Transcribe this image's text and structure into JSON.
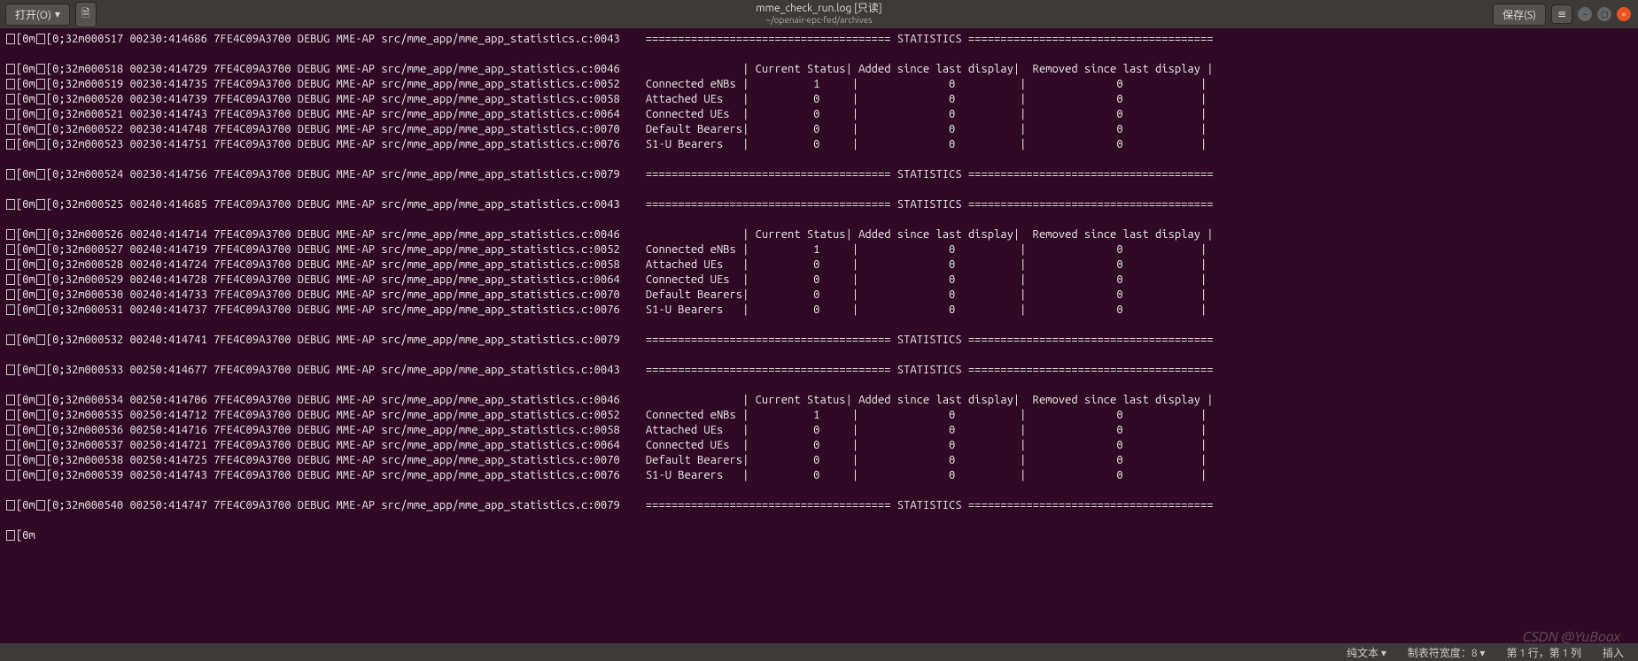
{
  "titlebar": {
    "open_label": "打开(O)",
    "dropdown_glyph": "▾",
    "doc_icon": "🗎",
    "title": "mme_check_run.log [只读]",
    "subtitle": "~/openair-epc-fed/archives",
    "save_label": "保存(S)",
    "menu_glyph": "≡",
    "min_glyph": "–",
    "max_glyph": "▢",
    "close_glyph": "×"
  },
  "log": {
    "prefix_glyph": "▯",
    "esc1": "[0m",
    "esc2": "[0;32m",
    "thread": "7FE4C09A3700",
    "level": "DEBUG",
    "module": "MME-AP",
    "path": "src/mme_app/mme_app_statistics.c:",
    "header_cols": [
      "Current Status",
      "Added since last display",
      "Removed since last display"
    ],
    "row_labels": [
      "Connected eNBs ",
      "Attached UEs   ",
      "Connected UEs  ",
      "Default Bearers",
      "S1-U Bearers   "
    ],
    "stats_banner": "STATISTICS",
    "blocks": [
      {
        "top_id": "000517",
        "top_ts": "00230:414686",
        "top_ln": "0043",
        "top_visible": false,
        "header_id": "000518",
        "header_ts": "00230:414729",
        "header_ln": "0046",
        "rows": [
          {
            "id": "000519",
            "ts": "00230:414735",
            "ln": "0052",
            "v": [
              1,
              0,
              0
            ]
          },
          {
            "id": "000520",
            "ts": "00230:414739",
            "ln": "0058",
            "v": [
              0,
              0,
              0
            ]
          },
          {
            "id": "000521",
            "ts": "00230:414743",
            "ln": "0064",
            "v": [
              0,
              0,
              0
            ]
          },
          {
            "id": "000522",
            "ts": "00230:414748",
            "ln": "0070",
            "v": [
              0,
              0,
              0
            ]
          },
          {
            "id": "000523",
            "ts": "00230:414751",
            "ln": "0076",
            "v": [
              0,
              0,
              0
            ]
          }
        ],
        "end_id": "000524",
        "end_ts": "00230:414756",
        "end_ln": "0079",
        "next_id": "000525",
        "next_ts": "00240:414685",
        "next_ln": "0043"
      },
      {
        "header_id": "000526",
        "header_ts": "00240:414714",
        "header_ln": "0046",
        "rows": [
          {
            "id": "000527",
            "ts": "00240:414719",
            "ln": "0052",
            "v": [
              1,
              0,
              0
            ]
          },
          {
            "id": "000528",
            "ts": "00240:414724",
            "ln": "0058",
            "v": [
              0,
              0,
              0
            ]
          },
          {
            "id": "000529",
            "ts": "00240:414728",
            "ln": "0064",
            "v": [
              0,
              0,
              0
            ]
          },
          {
            "id": "000530",
            "ts": "00240:414733",
            "ln": "0070",
            "v": [
              0,
              0,
              0
            ]
          },
          {
            "id": "000531",
            "ts": "00240:414737",
            "ln": "0076",
            "v": [
              0,
              0,
              0
            ]
          }
        ],
        "end_id": "000532",
        "end_ts": "00240:414741",
        "end_ln": "0079",
        "next_id": "000533",
        "next_ts": "00250:414677",
        "next_ln": "0043"
      },
      {
        "header_id": "000534",
        "header_ts": "00250:414706",
        "header_ln": "0046",
        "rows": [
          {
            "id": "000535",
            "ts": "00250:414712",
            "ln": "0052",
            "v": [
              1,
              0,
              0
            ]
          },
          {
            "id": "000536",
            "ts": "00250:414716",
            "ln": "0058",
            "v": [
              0,
              0,
              0
            ]
          },
          {
            "id": "000537",
            "ts": "00250:414721",
            "ln": "0064",
            "v": [
              0,
              0,
              0
            ]
          },
          {
            "id": "000538",
            "ts": "00250:414725",
            "ln": "0070",
            "v": [
              0,
              0,
              0
            ]
          },
          {
            "id": "000539",
            "ts": "00250:414743",
            "ln": "0076",
            "v": [
              0,
              0,
              0
            ]
          }
        ],
        "end_id": "000540",
        "end_ts": "00250:414747",
        "end_ln": "0079"
      }
    ]
  },
  "statusbar": {
    "mode": "纯文本 ▾",
    "tabwidth": "制表符宽度：8 ▾",
    "position": "第 1 行，第 1 列",
    "insert": "插入"
  },
  "watermark": "CSDN @YuBoox"
}
